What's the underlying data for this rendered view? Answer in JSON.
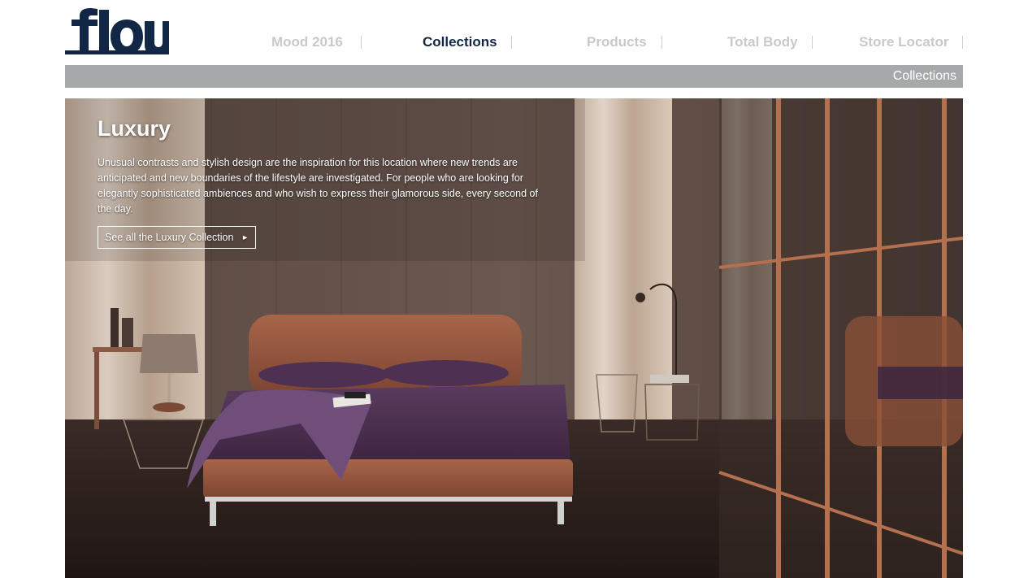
{
  "brand": {
    "logo_text": "flou",
    "logo_color": "#122746"
  },
  "nav": {
    "items": [
      {
        "label": "Mood 2016",
        "active": false
      },
      {
        "label": "Collections",
        "active": true
      },
      {
        "label": "Products",
        "active": false
      },
      {
        "label": "Total Body",
        "active": false
      },
      {
        "label": "Store Locator",
        "active": false
      }
    ],
    "active_color": "#122746",
    "inactive_color": "#c9c9c9"
  },
  "breadcrumb": {
    "label": "Collections",
    "bar_color": "#a6a9aa"
  },
  "hero": {
    "title": "Luxury",
    "description": "Unusual contrasts and stylish design are the inspiration for this location where new trends are anticipated and new boundaries of the lifestyle are investigated. For people who are looking for elegantly sophisticated ambiences and who wish to express their glamorous side, every second of the day.",
    "cta_label": "See all the Luxury Collection",
    "cta_icon": "chevron-right-icon"
  }
}
